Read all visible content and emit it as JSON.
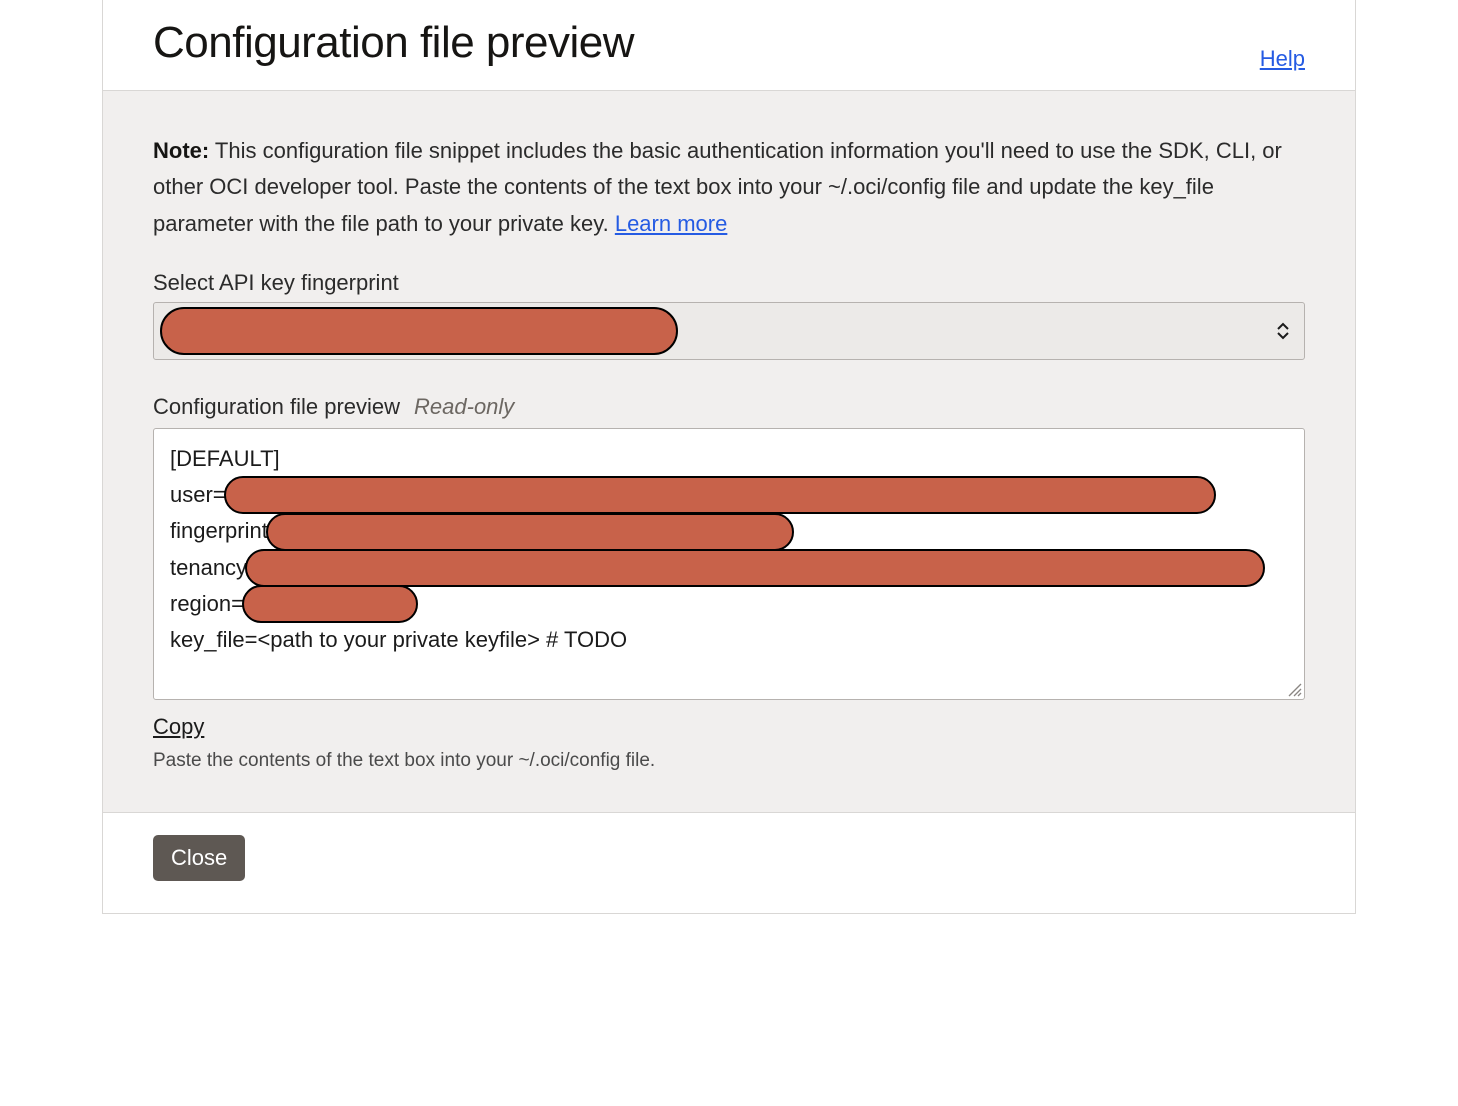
{
  "header": {
    "title": "Configuration file preview",
    "help_label": "Help"
  },
  "note": {
    "prefix": "Note:",
    "body": " This configuration file snippet includes the basic authentication information you'll need to use the SDK, CLI, or other OCI developer tool. Paste the contents of the text box into your ~/.oci/config file and update the key_file parameter with the file path to your private key. ",
    "learn_more": "Learn more"
  },
  "fingerprint": {
    "label": "Select API key fingerprint",
    "selected_value": "[redacted]"
  },
  "preview": {
    "label": "Configuration file preview",
    "readonly_tag": "Read-only",
    "lines": {
      "l0": "[DEFAULT]",
      "l1_key": "user=",
      "l1_val": "[redacted]",
      "l2_key": "fingerprint",
      "l2_val": "[redacted]",
      "l3_key": "tenancy",
      "l3_val": "[redacted]",
      "l4_key": "region=",
      "l4_val": "[redacted]",
      "l5": "key_file=<path to your private keyfile> # TODO"
    }
  },
  "actions": {
    "copy_label": "Copy",
    "hint": "Paste the contents of the text box into your ~/.oci/config file.",
    "close_label": "Close"
  }
}
